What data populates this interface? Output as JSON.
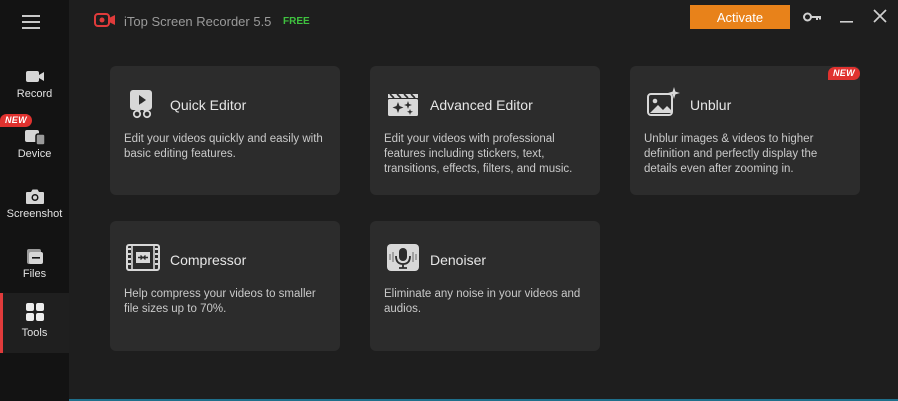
{
  "app": {
    "title": "iTop Screen Recorder 5.5",
    "edition": "FREE",
    "activate_label": "Activate",
    "accent_color": "#e03b3b",
    "activate_color": "#e8821a",
    "free_color": "#3fc23f"
  },
  "sidebar": {
    "items": [
      {
        "id": "record",
        "label": "Record",
        "icon": "camera-icon"
      },
      {
        "id": "device",
        "label": "Device",
        "icon": "device-icon",
        "badge": "NEW"
      },
      {
        "id": "screenshot",
        "label": "Screenshot",
        "icon": "screenshot-icon"
      },
      {
        "id": "files",
        "label": "Files",
        "icon": "files-icon"
      },
      {
        "id": "tools",
        "label": "Tools",
        "icon": "tools-grid-icon",
        "active": true
      }
    ]
  },
  "tools": [
    {
      "id": "quick-editor",
      "title": "Quick Editor",
      "desc": "Edit your videos quickly and easily with basic editing features.",
      "icon": "quick-editor-icon"
    },
    {
      "id": "advanced-editor",
      "title": "Advanced Editor",
      "desc": "Edit your videos with professional features including stickers, text, transitions, effects, filters, and music.",
      "icon": "clapperboard-icon"
    },
    {
      "id": "unblur",
      "title": "Unblur",
      "desc": "Unblur images & videos to higher definition and perfectly display the details even after zooming in.",
      "icon": "image-sparkle-icon",
      "badge": "NEW"
    },
    {
      "id": "compressor",
      "title": "Compressor",
      "desc": "Help compress your videos to smaller file sizes up to 70%.",
      "icon": "film-compress-icon"
    },
    {
      "id": "denoiser",
      "title": "Denoiser",
      "desc": "Eliminate any noise in your videos and audios.",
      "icon": "microphone-icon"
    }
  ]
}
